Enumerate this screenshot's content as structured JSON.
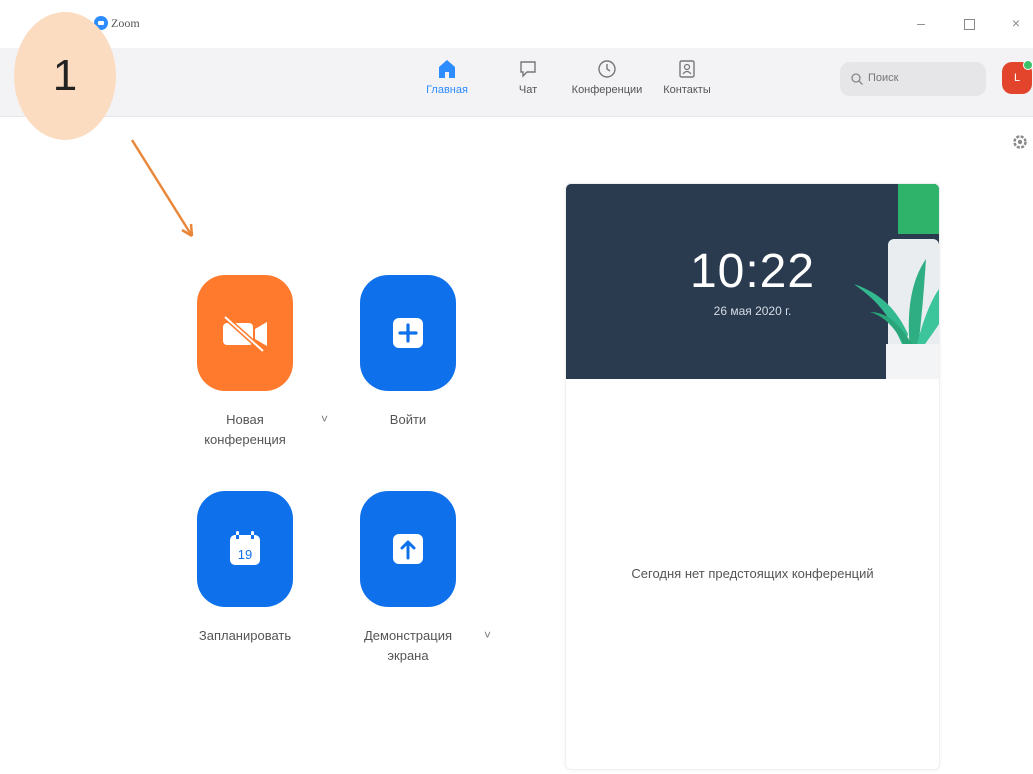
{
  "window": {
    "title": "Zoom",
    "minimize_glyph": "–",
    "close_glyph": "×"
  },
  "annotation": {
    "step_number": "1"
  },
  "nav": {
    "items": [
      {
        "label": "Главная",
        "icon": "home-icon",
        "active": true
      },
      {
        "label": "Чат",
        "icon": "chat-icon",
        "active": false
      },
      {
        "label": "Конференции",
        "icon": "clock-icon",
        "active": false
      },
      {
        "label": "Контакты",
        "icon": "contacts-icon",
        "active": false
      }
    ]
  },
  "search": {
    "placeholder": "Поиск"
  },
  "avatar": {
    "initial": "L",
    "status_color": "#3cc36a"
  },
  "actions": {
    "new_meeting_label_line1": "Новая",
    "new_meeting_label_line2": "конференция",
    "join_label": "Войти",
    "schedule_label": "Запланировать",
    "schedule_icon_day": "19",
    "share_label_line1": "Демонстрация",
    "share_label_line2": "экрана",
    "dropdown_glyph": "˅"
  },
  "colors": {
    "accent_blue": "#0e71eb",
    "accent_orange": "#ff7a2d",
    "nav_active": "#2d8cff"
  },
  "upcoming": {
    "time": "10:22",
    "date": "26 мая 2020 г.",
    "empty_message": "Сегодня нет предстоящих конференций"
  }
}
